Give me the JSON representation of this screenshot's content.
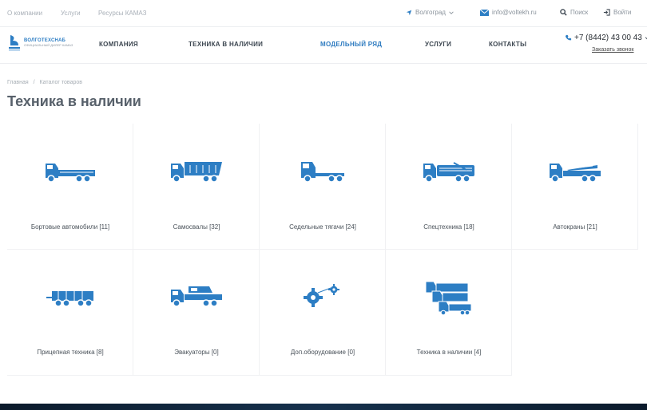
{
  "topbar": {
    "links": [
      "О компании",
      "Услуги",
      "Ресурсы КАМАЗ"
    ],
    "city": "Волгоград",
    "email": "info@voltekh.ru",
    "search": "Поиск",
    "login": "Войти"
  },
  "header": {
    "logo_line1": "ВОЛГОТЕХСНАБ",
    "logo_line2": "ОФИЦИАЛЬНЫЙ ДИЛЕР КАМАЗ",
    "nav": [
      "КОМПАНИЯ",
      "ТЕХНИКА В НАЛИЧИИ",
      "МОДЕЛЬНЫЙ РЯД",
      "УСЛУГИ",
      "КОНТАКТЫ"
    ],
    "phone": "+7 (8442) 43 00 43",
    "callback": "Заказать звонок"
  },
  "breadcrumbs": [
    "Главная",
    "/",
    "Каталог товаров"
  ],
  "page_title": "Техника в наличии",
  "categories": [
    {
      "label": "Бортовые автомобили [11]",
      "icon": "flatbed-truck-icon"
    },
    {
      "label": "Самосвалы [32]",
      "icon": "dump-truck-icon"
    },
    {
      "label": "Седельные тягачи [24]",
      "icon": "tractor-unit-icon"
    },
    {
      "label": "Спецтехника [18]",
      "icon": "special-truck-icon"
    },
    {
      "label": "Автокраны [21]",
      "icon": "crane-truck-icon"
    },
    {
      "label": "Прицепная техника [8]",
      "icon": "trailer-icon"
    },
    {
      "label": "Эвакуаторы [0]",
      "icon": "tow-truck-icon"
    },
    {
      "label": "Доп.оборудование [0]",
      "icon": "gears-icon"
    },
    {
      "label": "Техника в наличии [4]",
      "icon": "truck-fleet-icon"
    }
  ],
  "colors": {
    "accent": "#2e7bc0",
    "icon": "#2d7ec4"
  }
}
